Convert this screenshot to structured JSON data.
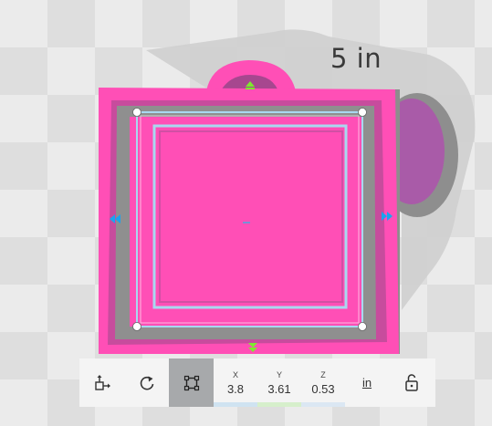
{
  "scene": {
    "dimension_label": "5 in",
    "object_color": "#ff4fb6",
    "selection_color": "#a8d8f0",
    "gizmo_colors": {
      "vertical_arrow": "#7dea2e",
      "horizontal_arrow": "#1ba4ef"
    }
  },
  "toolbar": {
    "x": {
      "axis": "X",
      "value": "3.8",
      "color": "#cfe3f1"
    },
    "y": {
      "axis": "Y",
      "value": "3.61",
      "color": "#d6efcb"
    },
    "z": {
      "axis": "Z",
      "value": "0.53",
      "color": "#dbe7f3"
    },
    "unit": "in"
  },
  "icons": {
    "move": "move-icon",
    "rotate": "rotate-icon",
    "scale": "scale-icon",
    "lock": "lock-open-icon"
  }
}
